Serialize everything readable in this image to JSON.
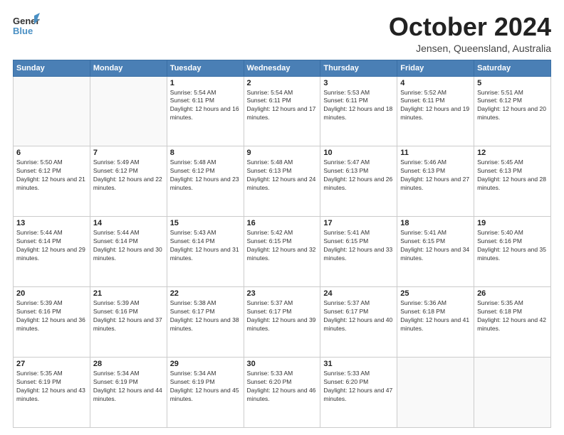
{
  "header": {
    "logo_general": "General",
    "logo_blue": "Blue",
    "month_title": "October 2024",
    "location": "Jensen, Queensland, Australia"
  },
  "days_of_week": [
    "Sunday",
    "Monday",
    "Tuesday",
    "Wednesday",
    "Thursday",
    "Friday",
    "Saturday"
  ],
  "weeks": [
    [
      {
        "day": "",
        "sunrise": "",
        "sunset": "",
        "daylight": ""
      },
      {
        "day": "",
        "sunrise": "",
        "sunset": "",
        "daylight": ""
      },
      {
        "day": "1",
        "sunrise": "Sunrise: 5:54 AM",
        "sunset": "Sunset: 6:11 PM",
        "daylight": "Daylight: 12 hours and 16 minutes."
      },
      {
        "day": "2",
        "sunrise": "Sunrise: 5:54 AM",
        "sunset": "Sunset: 6:11 PM",
        "daylight": "Daylight: 12 hours and 17 minutes."
      },
      {
        "day": "3",
        "sunrise": "Sunrise: 5:53 AM",
        "sunset": "Sunset: 6:11 PM",
        "daylight": "Daylight: 12 hours and 18 minutes."
      },
      {
        "day": "4",
        "sunrise": "Sunrise: 5:52 AM",
        "sunset": "Sunset: 6:11 PM",
        "daylight": "Daylight: 12 hours and 19 minutes."
      },
      {
        "day": "5",
        "sunrise": "Sunrise: 5:51 AM",
        "sunset": "Sunset: 6:12 PM",
        "daylight": "Daylight: 12 hours and 20 minutes."
      }
    ],
    [
      {
        "day": "6",
        "sunrise": "Sunrise: 5:50 AM",
        "sunset": "Sunset: 6:12 PM",
        "daylight": "Daylight: 12 hours and 21 minutes."
      },
      {
        "day": "7",
        "sunrise": "Sunrise: 5:49 AM",
        "sunset": "Sunset: 6:12 PM",
        "daylight": "Daylight: 12 hours and 22 minutes."
      },
      {
        "day": "8",
        "sunrise": "Sunrise: 5:48 AM",
        "sunset": "Sunset: 6:12 PM",
        "daylight": "Daylight: 12 hours and 23 minutes."
      },
      {
        "day": "9",
        "sunrise": "Sunrise: 5:48 AM",
        "sunset": "Sunset: 6:13 PM",
        "daylight": "Daylight: 12 hours and 24 minutes."
      },
      {
        "day": "10",
        "sunrise": "Sunrise: 5:47 AM",
        "sunset": "Sunset: 6:13 PM",
        "daylight": "Daylight: 12 hours and 26 minutes."
      },
      {
        "day": "11",
        "sunrise": "Sunrise: 5:46 AM",
        "sunset": "Sunset: 6:13 PM",
        "daylight": "Daylight: 12 hours and 27 minutes."
      },
      {
        "day": "12",
        "sunrise": "Sunrise: 5:45 AM",
        "sunset": "Sunset: 6:13 PM",
        "daylight": "Daylight: 12 hours and 28 minutes."
      }
    ],
    [
      {
        "day": "13",
        "sunrise": "Sunrise: 5:44 AM",
        "sunset": "Sunset: 6:14 PM",
        "daylight": "Daylight: 12 hours and 29 minutes."
      },
      {
        "day": "14",
        "sunrise": "Sunrise: 5:44 AM",
        "sunset": "Sunset: 6:14 PM",
        "daylight": "Daylight: 12 hours and 30 minutes."
      },
      {
        "day": "15",
        "sunrise": "Sunrise: 5:43 AM",
        "sunset": "Sunset: 6:14 PM",
        "daylight": "Daylight: 12 hours and 31 minutes."
      },
      {
        "day": "16",
        "sunrise": "Sunrise: 5:42 AM",
        "sunset": "Sunset: 6:15 PM",
        "daylight": "Daylight: 12 hours and 32 minutes."
      },
      {
        "day": "17",
        "sunrise": "Sunrise: 5:41 AM",
        "sunset": "Sunset: 6:15 PM",
        "daylight": "Daylight: 12 hours and 33 minutes."
      },
      {
        "day": "18",
        "sunrise": "Sunrise: 5:41 AM",
        "sunset": "Sunset: 6:15 PM",
        "daylight": "Daylight: 12 hours and 34 minutes."
      },
      {
        "day": "19",
        "sunrise": "Sunrise: 5:40 AM",
        "sunset": "Sunset: 6:16 PM",
        "daylight": "Daylight: 12 hours and 35 minutes."
      }
    ],
    [
      {
        "day": "20",
        "sunrise": "Sunrise: 5:39 AM",
        "sunset": "Sunset: 6:16 PM",
        "daylight": "Daylight: 12 hours and 36 minutes."
      },
      {
        "day": "21",
        "sunrise": "Sunrise: 5:39 AM",
        "sunset": "Sunset: 6:16 PM",
        "daylight": "Daylight: 12 hours and 37 minutes."
      },
      {
        "day": "22",
        "sunrise": "Sunrise: 5:38 AM",
        "sunset": "Sunset: 6:17 PM",
        "daylight": "Daylight: 12 hours and 38 minutes."
      },
      {
        "day": "23",
        "sunrise": "Sunrise: 5:37 AM",
        "sunset": "Sunset: 6:17 PM",
        "daylight": "Daylight: 12 hours and 39 minutes."
      },
      {
        "day": "24",
        "sunrise": "Sunrise: 5:37 AM",
        "sunset": "Sunset: 6:17 PM",
        "daylight": "Daylight: 12 hours and 40 minutes."
      },
      {
        "day": "25",
        "sunrise": "Sunrise: 5:36 AM",
        "sunset": "Sunset: 6:18 PM",
        "daylight": "Daylight: 12 hours and 41 minutes."
      },
      {
        "day": "26",
        "sunrise": "Sunrise: 5:35 AM",
        "sunset": "Sunset: 6:18 PM",
        "daylight": "Daylight: 12 hours and 42 minutes."
      }
    ],
    [
      {
        "day": "27",
        "sunrise": "Sunrise: 5:35 AM",
        "sunset": "Sunset: 6:19 PM",
        "daylight": "Daylight: 12 hours and 43 minutes."
      },
      {
        "day": "28",
        "sunrise": "Sunrise: 5:34 AM",
        "sunset": "Sunset: 6:19 PM",
        "daylight": "Daylight: 12 hours and 44 minutes."
      },
      {
        "day": "29",
        "sunrise": "Sunrise: 5:34 AM",
        "sunset": "Sunset: 6:19 PM",
        "daylight": "Daylight: 12 hours and 45 minutes."
      },
      {
        "day": "30",
        "sunrise": "Sunrise: 5:33 AM",
        "sunset": "Sunset: 6:20 PM",
        "daylight": "Daylight: 12 hours and 46 minutes."
      },
      {
        "day": "31",
        "sunrise": "Sunrise: 5:33 AM",
        "sunset": "Sunset: 6:20 PM",
        "daylight": "Daylight: 12 hours and 47 minutes."
      },
      {
        "day": "",
        "sunrise": "",
        "sunset": "",
        "daylight": ""
      },
      {
        "day": "",
        "sunrise": "",
        "sunset": "",
        "daylight": ""
      }
    ]
  ]
}
